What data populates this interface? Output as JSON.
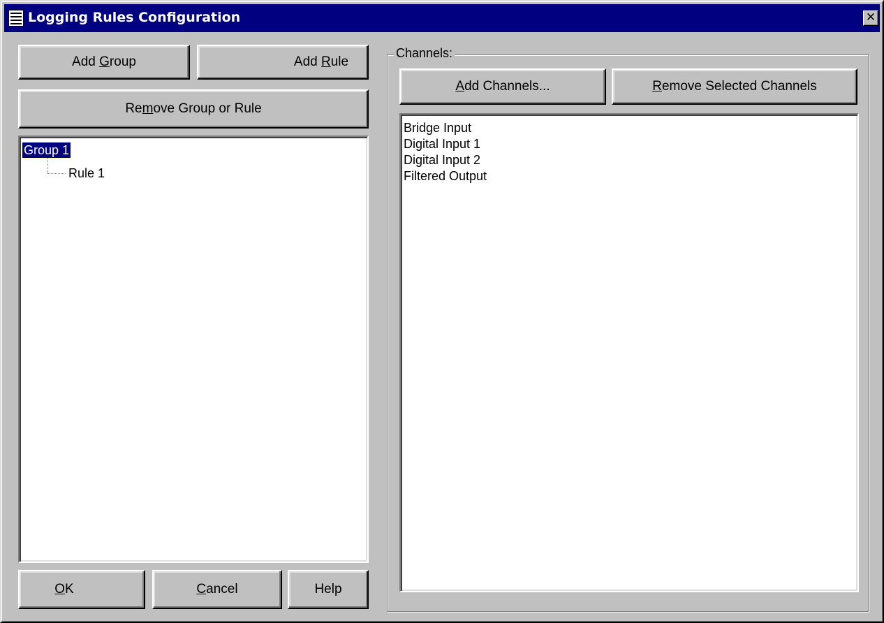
{
  "window": {
    "title": "Logging Rules Configuration",
    "close_glyph": "✕"
  },
  "buttons": {
    "add_group": {
      "pre": "Add ",
      "key": "G",
      "post": "roup"
    },
    "add_rule": {
      "pre": "Add ",
      "key": "R",
      "post": "ule"
    },
    "remove_group_or_rule": {
      "pre": "Re",
      "key": "m",
      "post": "ove Group or Rule"
    },
    "ok": {
      "pre": "",
      "key": "O",
      "post": "K"
    },
    "cancel": {
      "pre": "",
      "key": "C",
      "post": "ancel"
    },
    "help": {
      "pre": "Help",
      "key": "",
      "post": ""
    },
    "add_channels": {
      "pre": "",
      "key": "A",
      "post": "dd Channels..."
    },
    "remove_selected_channels": {
      "pre": "",
      "key": "R",
      "post": "emove Selected Channels"
    }
  },
  "tree": {
    "items": [
      {
        "label": "Group 1",
        "selected": true,
        "level": 0
      },
      {
        "label": "Rule 1",
        "selected": false,
        "level": 1
      }
    ]
  },
  "channels": {
    "label": "Channels:",
    "items": [
      "Bridge Input",
      "Digital Input 1",
      "Digital Input 2",
      "Filtered Output"
    ]
  },
  "colors": {
    "titlebar": "#000080",
    "face": "#c0c0c0",
    "selection": "#000080"
  },
  "icons": {
    "app": "app-icon",
    "close": "close-icon"
  }
}
